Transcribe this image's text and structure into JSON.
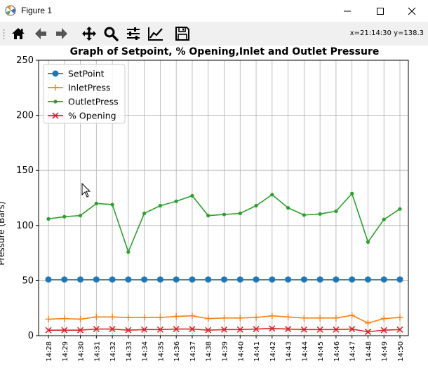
{
  "window": {
    "title": "Figure 1",
    "icons": [
      "matplotlib-icon",
      "minimize-icon",
      "maximize-icon",
      "close-icon"
    ]
  },
  "toolbar": {
    "buttons": [
      {
        "name": "home-icon"
      },
      {
        "name": "back-arrow-icon"
      },
      {
        "name": "forward-arrow-icon"
      },
      {
        "name": "pan-icon"
      },
      {
        "name": "zoom-icon"
      },
      {
        "name": "subplots-config-icon"
      },
      {
        "name": "edit-axis-icon"
      },
      {
        "name": "save-icon"
      }
    ],
    "coordinates": "x=21:14:30 y=138.3"
  },
  "chart_data": {
    "type": "line",
    "title": "Graph of Setpoint, % Opening,Inlet and Outlet Pressure",
    "xlabel": "",
    "ylabel": "Pressure (Bars)",
    "ylim": [
      0,
      250
    ],
    "yticks": [
      0,
      50,
      100,
      150,
      200,
      250
    ],
    "grid": true,
    "legend_position": "top-left",
    "categories": [
      "14:28",
      "14:29",
      "14:30",
      "14:31",
      "14:32",
      "14:33",
      "14:34",
      "14:35",
      "14:36",
      "14:37",
      "14:38",
      "14:39",
      "14:40",
      "14:41",
      "14:42",
      "14:43",
      "14:44",
      "14:45",
      "14:46",
      "14:47",
      "14:48",
      "14:49",
      "14:50"
    ],
    "series": [
      {
        "name": "SetPoint",
        "color": "#1f77b4",
        "marker": "circle",
        "values": [
          51,
          51,
          51,
          51,
          51,
          51,
          51,
          51,
          51,
          51,
          51,
          51,
          51,
          51,
          51,
          51,
          51,
          51,
          51,
          51,
          51,
          51,
          51
        ]
      },
      {
        "name": "InletPress",
        "color": "#ff7f0e",
        "marker": "plus",
        "values": [
          15,
          15.5,
          15,
          17,
          17,
          16.5,
          16.5,
          16.5,
          17.5,
          18,
          15.5,
          16,
          16,
          16.5,
          18,
          17,
          16,
          16,
          16,
          18.5,
          11.5,
          15.5,
          16.5
        ]
      },
      {
        "name": "OutletPress",
        "color": "#2ca02c",
        "marker": "dot",
        "values": [
          106,
          108,
          109,
          120,
          119,
          76,
          111,
          118,
          122,
          127,
          109,
          110,
          111,
          118,
          128,
          116,
          109.5,
          110.5,
          113,
          129,
          85,
          105.5,
          115
        ]
      },
      {
        "name": "% Opening",
        "color": "#d62728",
        "marker": "x",
        "values": [
          5,
          5,
          5,
          6,
          6,
          5,
          5.5,
          5.5,
          6,
          6,
          5,
          5.5,
          5.5,
          6,
          6.5,
          6,
          5.5,
          5.5,
          5.5,
          6,
          3.5,
          5,
          5.5
        ]
      }
    ]
  }
}
